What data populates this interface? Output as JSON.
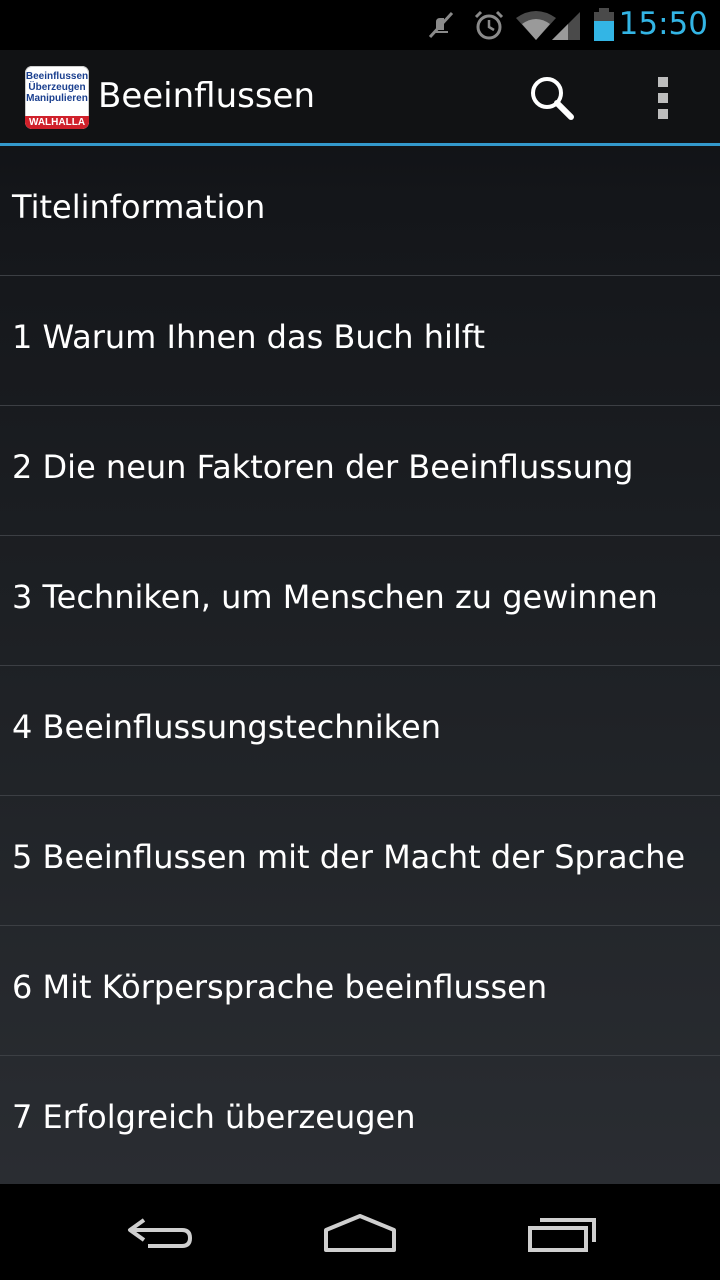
{
  "status_bar": {
    "time": "15:50",
    "icons": [
      "mute-icon",
      "alarm-icon",
      "wifi-icon",
      "signal-icon",
      "battery-icon"
    ],
    "accent_color": "#33b5e5"
  },
  "action_bar": {
    "title": "Beeinflussen",
    "app_icon": {
      "lines": [
        "Beeinflussen",
        "Überzeugen",
        "Manipulieren"
      ],
      "band": "WALHALLA"
    },
    "actions": [
      "search-icon",
      "overflow-menu-icon"
    ],
    "divider_color": "#3399cc"
  },
  "list": {
    "items": [
      {
        "label": "Titelinformation"
      },
      {
        "label": "1 Warum Ihnen das Buch hilft"
      },
      {
        "label": "2 Die neun Faktoren der Beeinflussung"
      },
      {
        "label": "3 Techniken, um Menschen zu gewinnen"
      },
      {
        "label": "4 Beeinflussungstechniken"
      },
      {
        "label": "5 Beeinflussen mit der Macht der Sprache"
      },
      {
        "label": "6 Mit Körpersprache beeinflussen"
      },
      {
        "label": "7 Erfolgreich überzeugen"
      }
    ]
  },
  "nav_bar": {
    "buttons": [
      "back-icon",
      "home-icon",
      "recent-apps-icon"
    ]
  }
}
